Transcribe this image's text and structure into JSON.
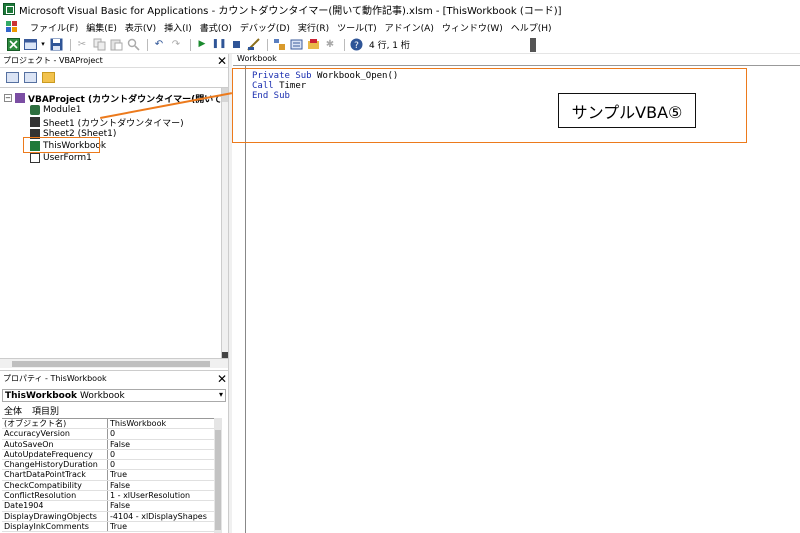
{
  "window": {
    "title": "Microsoft Visual Basic for Applications - カウントダウンタイマー(開いて動作記事).xlsm - [ThisWorkbook (コード)]"
  },
  "menu": {
    "items": [
      "ファイル(F)",
      "編集(E)",
      "表示(V)",
      "挿入(I)",
      "書式(O)",
      "デバッグ(D)",
      "実行(R)",
      "ツール(T)",
      "アドイン(A)",
      "ウィンドウ(W)",
      "ヘルプ(H)"
    ]
  },
  "toolbar": {
    "position": "4 行, 1 桁"
  },
  "project_pane": {
    "title": "プロジェクト - VBAProject",
    "tree": [
      {
        "label": "VBAProject (カウントダウンタイマー(開いて動作記事",
        "icon": "project-icon"
      },
      {
        "label": "Module1",
        "icon": "module-icon"
      },
      {
        "label": "Sheet1 (カウントダウンタイマー)",
        "icon": "sheet-icon"
      },
      {
        "label": "Sheet2 (Sheet1)",
        "icon": "sheet-icon"
      },
      {
        "label": "ThisWorkbook",
        "icon": "workbook-icon"
      },
      {
        "label": "UserForm1",
        "icon": "userform-icon"
      }
    ]
  },
  "properties_pane": {
    "title": "プロパティ - ThisWorkbook",
    "object_name": "ThisWorkbook",
    "object_type": "Workbook",
    "tabs": [
      "全体",
      "項目別"
    ],
    "rows": [
      {
        "name": "(オブジェクト名)",
        "value": "ThisWorkbook"
      },
      {
        "name": "AccuracyVersion",
        "value": "0"
      },
      {
        "name": "AutoSaveOn",
        "value": "False"
      },
      {
        "name": "AutoUpdateFrequency",
        "value": "0"
      },
      {
        "name": "ChangeHistoryDuration",
        "value": "0"
      },
      {
        "name": "ChartDataPointTrack",
        "value": "True"
      },
      {
        "name": "CheckCompatibility",
        "value": "False"
      },
      {
        "name": "ConflictResolution",
        "value": "1 - xlUserResolution"
      },
      {
        "name": "Date1904",
        "value": "False"
      },
      {
        "name": "DisplayDrawingObjects",
        "value": "-4104 - xlDisplayShapes"
      },
      {
        "name": "DisplayInkComments",
        "value": "True"
      }
    ]
  },
  "code_window": {
    "object_combo": "Workbook",
    "lines": [
      {
        "kw": "Private Sub ",
        "text": "Workbook_Open()"
      },
      {
        "kw": "Call ",
        "text": "Timer"
      },
      {
        "kw": "End Sub",
        "text": ""
      }
    ]
  },
  "annotation": {
    "label": "サンプルVBA⑤",
    "color": "#ec7a1c"
  }
}
